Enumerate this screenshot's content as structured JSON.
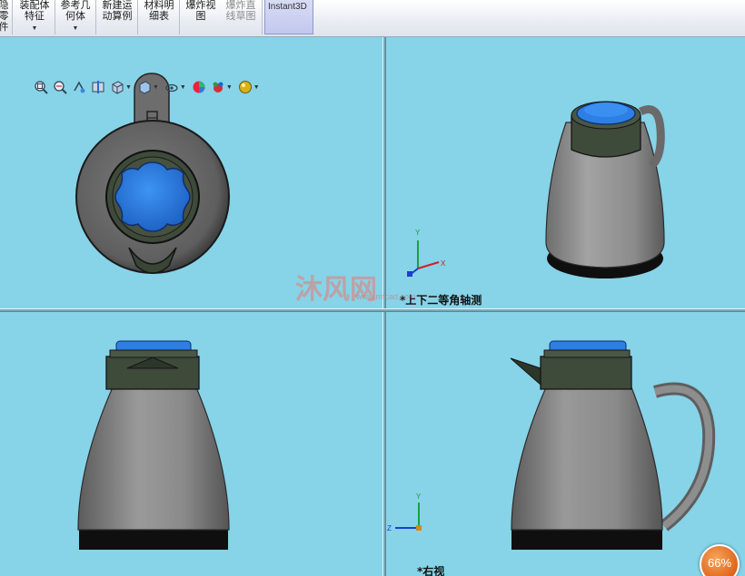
{
  "ribbon": {
    "items": [
      {
        "label1": "隐",
        "label2": "零",
        "label3": "件",
        "has_caret": false,
        "disabled": false
      },
      {
        "label1": "装配体",
        "label2": "特征",
        "has_caret": true,
        "disabled": false
      },
      {
        "label1": "参考几",
        "label2": "何体",
        "has_caret": true,
        "disabled": false
      },
      {
        "label1": "新建运",
        "label2": "动算例",
        "has_caret": false,
        "disabled": false
      },
      {
        "label1": "材料明",
        "label2": "细表",
        "has_caret": false,
        "disabled": false
      },
      {
        "label1": "爆炸视",
        "label2": "图",
        "has_caret": false,
        "disabled": false
      },
      {
        "label1": "爆炸直",
        "label2": "线草图",
        "has_caret": false,
        "disabled": true
      }
    ],
    "instant3d": "Instant3D"
  },
  "hud_icons": [
    "zoom-to-fit-icon",
    "zoom-to-area-icon",
    "previous-view-icon",
    "section-view-icon",
    "view-orientation-icon",
    "display-style-icon",
    "hide-show-items-icon",
    "edit-appearance-icon",
    "apply-scene-icon",
    "view-settings-icon"
  ],
  "views": {
    "top_right_label": "*上下二等角轴测",
    "bottom_right_label": "*右视"
  },
  "triad": {
    "x": "X",
    "y": "Y",
    "z": "Z"
  },
  "watermark": {
    "text": "沐风网",
    "url": "www.mfcad.com"
  },
  "zoom_badge": "66%",
  "colors": {
    "background": "#87d3e8",
    "lid_blue": "#2f7fe0",
    "body_gray": "#8e8e8e",
    "collar": "#3e4a3a",
    "base": "#111111"
  }
}
